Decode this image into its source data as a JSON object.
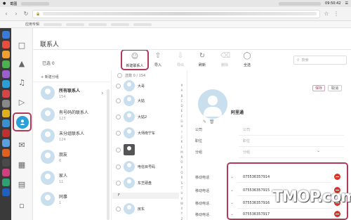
{
  "menubar": {
    "app": "截图",
    "time": "09:50:42"
  },
  "browser": {
    "bookmarks_label": "应用专辑"
  },
  "header": {
    "title": "联系人",
    "selected_label": "已选 0"
  },
  "toolbar": {
    "new_contact": "新建联系人",
    "import": "导入",
    "export": "导出",
    "refresh": "刷新",
    "delete": "删除",
    "all": "全选"
  },
  "search": {
    "placeholder": "搜索"
  },
  "groups_pane": {
    "new_group": "+ 新建分组",
    "groups": [
      {
        "name": "所有联系人",
        "count": "154"
      },
      {
        "name": "有号码的联系人",
        "count": "123"
      },
      {
        "name": "未分组联系人",
        "count": "124"
      },
      {
        "name": "朋友",
        "count": "6"
      },
      {
        "name": "家人",
        "count": "11"
      },
      {
        "name": "同事",
        "count": "1"
      }
    ]
  },
  "contacts_pane": {
    "selected_ratio": "选数 0 / 154",
    "contacts": [
      {
        "name": "大哥"
      },
      {
        "name": "大姑"
      },
      {
        "name": "大姑2"
      },
      {
        "name": "大师南宁车"
      },
      {
        "name": ""
      },
      {
        "name": "电信目号码"
      },
      {
        "name": "东芝硬盘"
      },
      {
        "name": "房东"
      }
    ],
    "section_letter": "F",
    "alphabet": [
      "#",
      "A",
      "B",
      "C",
      "D",
      "E",
      "F",
      "G",
      "H",
      "I",
      "J",
      "K",
      "L",
      "M",
      "N",
      "O",
      "P",
      "Q",
      "R",
      "S",
      "T",
      "U",
      "V",
      "W",
      "X",
      "Y",
      "Z"
    ]
  },
  "detail": {
    "name": "阿里通",
    "save": "保存",
    "cancel": "取消",
    "fields": [
      {
        "label": "公司",
        "placeholder": "公司"
      },
      {
        "label": "职位",
        "placeholder": "职位"
      },
      {
        "label": "分组",
        "placeholder": "分组"
      }
    ],
    "phones": [
      {
        "label": "移动电话",
        "number": "075536357914"
      },
      {
        "label": "移动电话",
        "number": "075536357915"
      },
      {
        "label": "移动电话",
        "number": "075536357916"
      },
      {
        "label": "移动电话",
        "number": "075536357917"
      }
    ]
  },
  "watermark": "TMOP.com",
  "colors": {
    "accent": "#2a9fd8",
    "highlight_border": "#b03a5a",
    "delete_red": "#d9342b"
  },
  "icons": {
    "nav": [
      "window-icon",
      "mountain-image-icon",
      "music-note-icon",
      "play-icon",
      "contacts-icon",
      "message-icon",
      "grid-icon",
      "document-icon",
      "folder-icon"
    ]
  }
}
